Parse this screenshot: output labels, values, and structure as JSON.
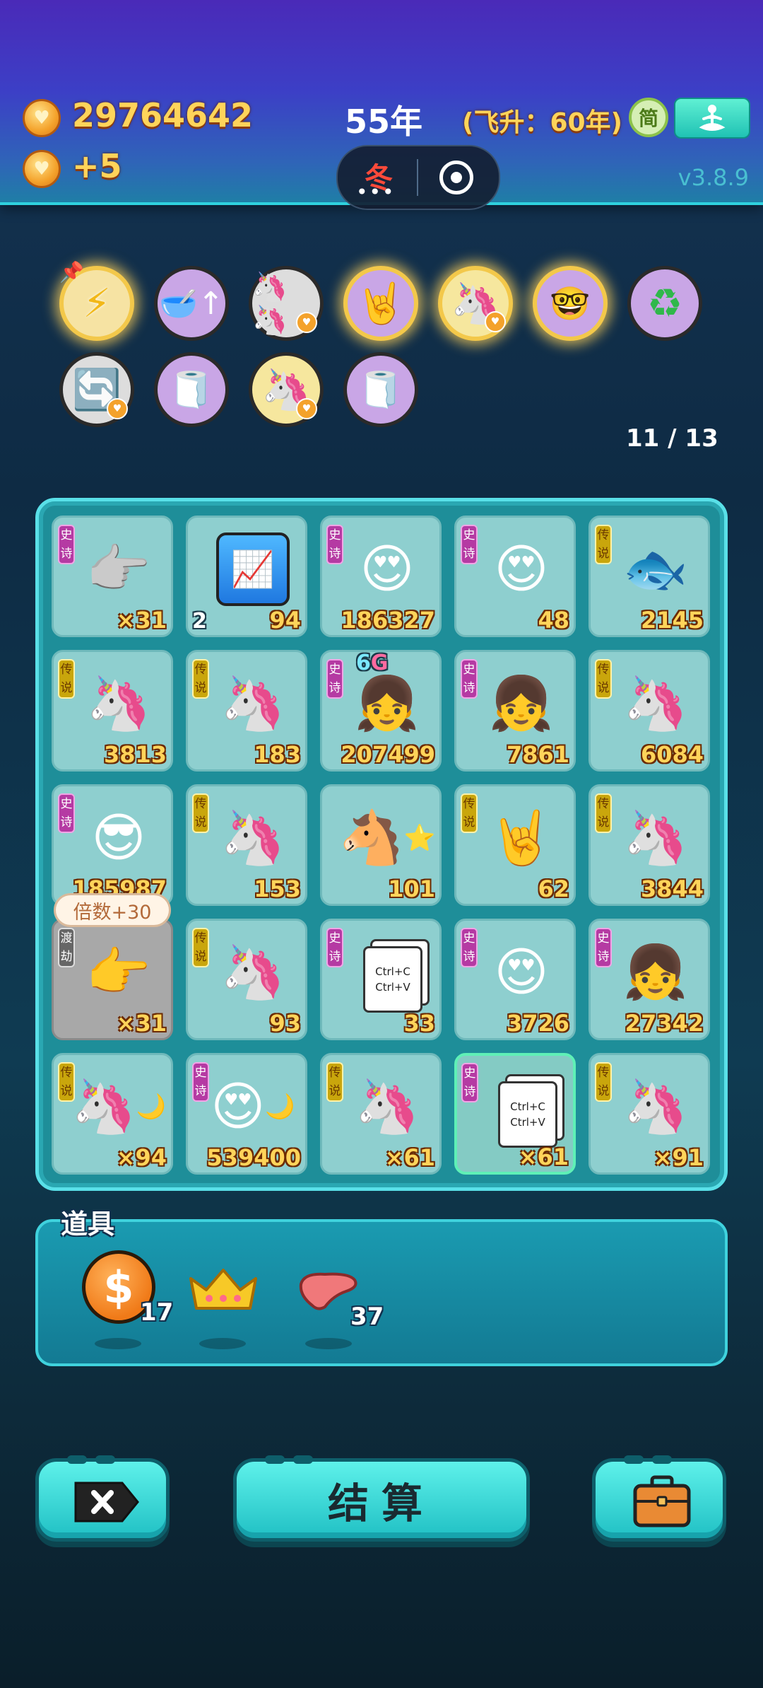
{
  "header": {
    "coins": "29764642",
    "income": "+5",
    "year": "55年",
    "ascend": "(飞升：60年)",
    "season": "冬",
    "simplified_label": "简",
    "version": "v3.8.9"
  },
  "buffs": {
    "items": [
      {
        "name": "lightning"
      },
      {
        "name": "bowls"
      },
      {
        "name": "twin-unicorn"
      },
      {
        "name": "rock-hand"
      },
      {
        "name": "unicorn-gold"
      },
      {
        "name": "math-face"
      },
      {
        "name": "recycle"
      },
      {
        "name": "refresh"
      },
      {
        "name": "tissue"
      },
      {
        "name": "unicorn"
      },
      {
        "name": "tissue"
      }
    ],
    "count": "11 / 13"
  },
  "board": {
    "cells": [
      {
        "tag": "史诗",
        "value": "×31"
      },
      {
        "tag": "",
        "left": "2",
        "value": "94"
      },
      {
        "tag": "史诗",
        "value": "186327"
      },
      {
        "tag": "史诗",
        "value": "48"
      },
      {
        "tag": "传说",
        "value": "2145"
      },
      {
        "tag": "传说",
        "value": "3813"
      },
      {
        "tag": "传说",
        "value": "183"
      },
      {
        "tag": "史诗",
        "value": "207499",
        "badge": "6",
        "badge2": "G"
      },
      {
        "tag": "史诗",
        "value": "7861"
      },
      {
        "tag": "传说",
        "value": "6084"
      },
      {
        "tag": "史诗",
        "value": "185987"
      },
      {
        "tag": "传说",
        "value": "153"
      },
      {
        "tag": "",
        "value": "101"
      },
      {
        "tag": "传说",
        "value": "62"
      },
      {
        "tag": "传说",
        "value": "3844"
      },
      {
        "tag": "渡劫",
        "value": "×31"
      },
      {
        "tag": "传说",
        "value": "93"
      },
      {
        "tag": "史诗",
        "value": "33"
      },
      {
        "tag": "史诗",
        "value": "3726"
      },
      {
        "tag": "史诗",
        "value": "27342"
      },
      {
        "tag": "传说",
        "value": "×94"
      },
      {
        "tag": "史诗",
        "value": "539400"
      },
      {
        "tag": "传说",
        "value": "×61"
      },
      {
        "tag": "史诗",
        "value": "×61"
      },
      {
        "tag": "传说",
        "value": "×91"
      }
    ],
    "bubble": "倍数+30",
    "copy_line1": "Ctrl+C",
    "copy_line2": "Ctrl+V"
  },
  "tools": {
    "label": "道具",
    "coin_count": "17",
    "liver_count": "37"
  },
  "buttons": {
    "settle": "结算"
  }
}
